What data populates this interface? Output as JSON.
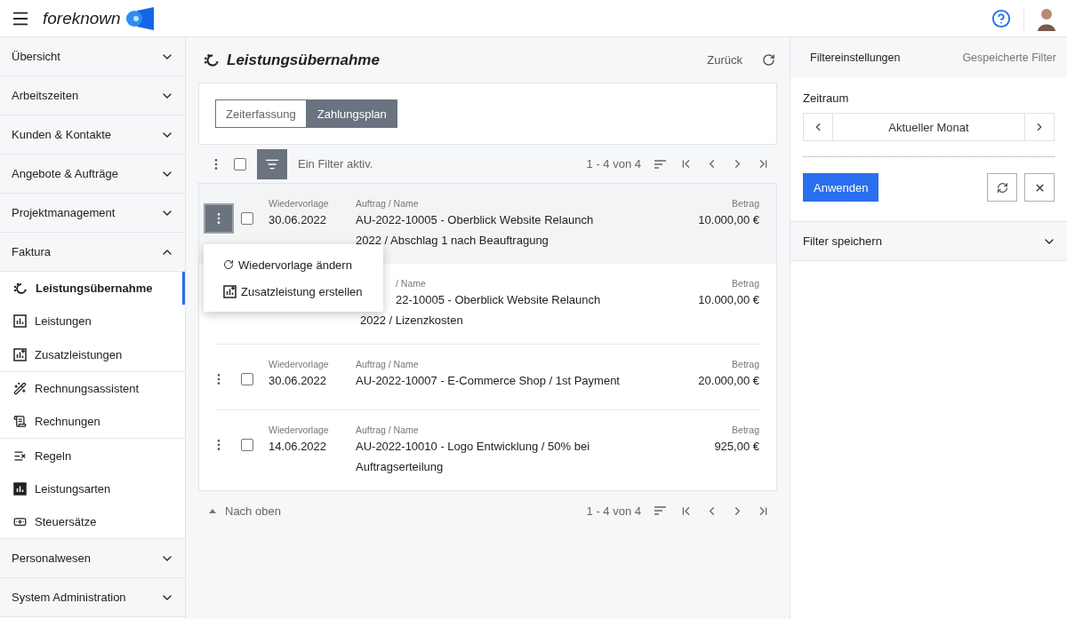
{
  "header": {
    "logo_text": "foreknown"
  },
  "sidebar": {
    "groups": [
      {
        "label": "Übersicht",
        "expanded": false
      },
      {
        "label": "Arbeitszeiten",
        "expanded": false
      },
      {
        "label": "Kunden & Kontakte",
        "expanded": false
      },
      {
        "label": "Angebote & Aufträge",
        "expanded": false
      },
      {
        "label": "Projektmanagement",
        "expanded": false
      },
      {
        "label": "Faktura",
        "expanded": true,
        "children": [
          {
            "children": [
              {
                "label": "Leistungsübernahme",
                "selected": true
              },
              {
                "label": "Leistungen",
                "selected": false
              },
              {
                "label": "Zusatzleistungen",
                "selected": false
              }
            ]
          },
          {
            "children": [
              {
                "label": "Rechnungsassistent",
                "selected": false
              },
              {
                "label": "Rechnungen",
                "selected": false
              }
            ]
          },
          {
            "children": [
              {
                "label": "Regeln",
                "selected": false
              },
              {
                "label": "Leistungsarten",
                "selected": false
              },
              {
                "label": "Steuersätze",
                "selected": false
              }
            ]
          }
        ]
      },
      {
        "label": "Personalwesen",
        "expanded": false
      },
      {
        "label": "System Administration",
        "expanded": false
      }
    ]
  },
  "main": {
    "title": "Leistungsübernahme",
    "back": "Zurück",
    "tabs": [
      {
        "label": "Zeiterfassung",
        "selected": false
      },
      {
        "label": "Zahlungsplan",
        "selected": true
      }
    ],
    "toolbar": {
      "all_checked": false,
      "filter_text": "Ein Filter aktiv.",
      "range": "1 - 4 von 4"
    },
    "rows": [
      {
        "selected": true,
        "menu_open": true,
        "checked": false,
        "date_label": "Wiedervorlage",
        "date": "30.06.2022",
        "name_label": "Auftrag / Name",
        "name": "AU-2022-10005 - Oberblick Website Relaunch",
        "name_continued": "2022 / Abschlag 1 nach Beauftragung",
        "amount_label": "Betrag",
        "amount": "10.000,00 €"
      },
      {
        "selected": false,
        "covered": true,
        "name_label": "/ Name",
        "name": "22-10005 - Oberblick Website Relaunch",
        "name_continued": "2022 / Lizenzkosten",
        "amount_label": "Betrag",
        "amount": "10.000,00 €"
      },
      {
        "selected": false,
        "menu_open": false,
        "checked": false,
        "date_label": "Wiedervorlage",
        "date": "30.06.2022",
        "name_label": "Auftrag / Name",
        "name": "AU-2022-10007 - E-Commerce Shop / 1st Payment",
        "amount_label": "Betrag",
        "amount": "20.000,00 €"
      },
      {
        "selected": false,
        "menu_open": false,
        "checked": false,
        "date_label": "Wiedervorlage",
        "date": "14.06.2022",
        "name_label": "Auftrag / Name",
        "name": "AU-2022-10010 - Logo Entwicklung / 50% bei",
        "name_continued": "Auftragserteilung",
        "amount_label": "Betrag",
        "amount": "925,00 €"
      }
    ],
    "row_menu": {
      "items": [
        {
          "label": "Wiedervorlage ändern",
          "kind": "reschedule"
        },
        {
          "label": "Zusatzleistung erstellen",
          "kind": "add"
        }
      ]
    },
    "footer": {
      "back_to_top": "Nach oben",
      "range": "1 - 4 von 4"
    }
  },
  "filter_panel": {
    "tabs": [
      {
        "label": "Filtereinstellungen",
        "selected": true
      },
      {
        "label": "Gespeicherte Filter",
        "selected": false
      }
    ],
    "period_label": "Zeitraum",
    "period_value": "Aktueller Monat",
    "apply": "Anwenden",
    "save_section": {
      "label": "Filter speichern",
      "expanded": false
    }
  }
}
